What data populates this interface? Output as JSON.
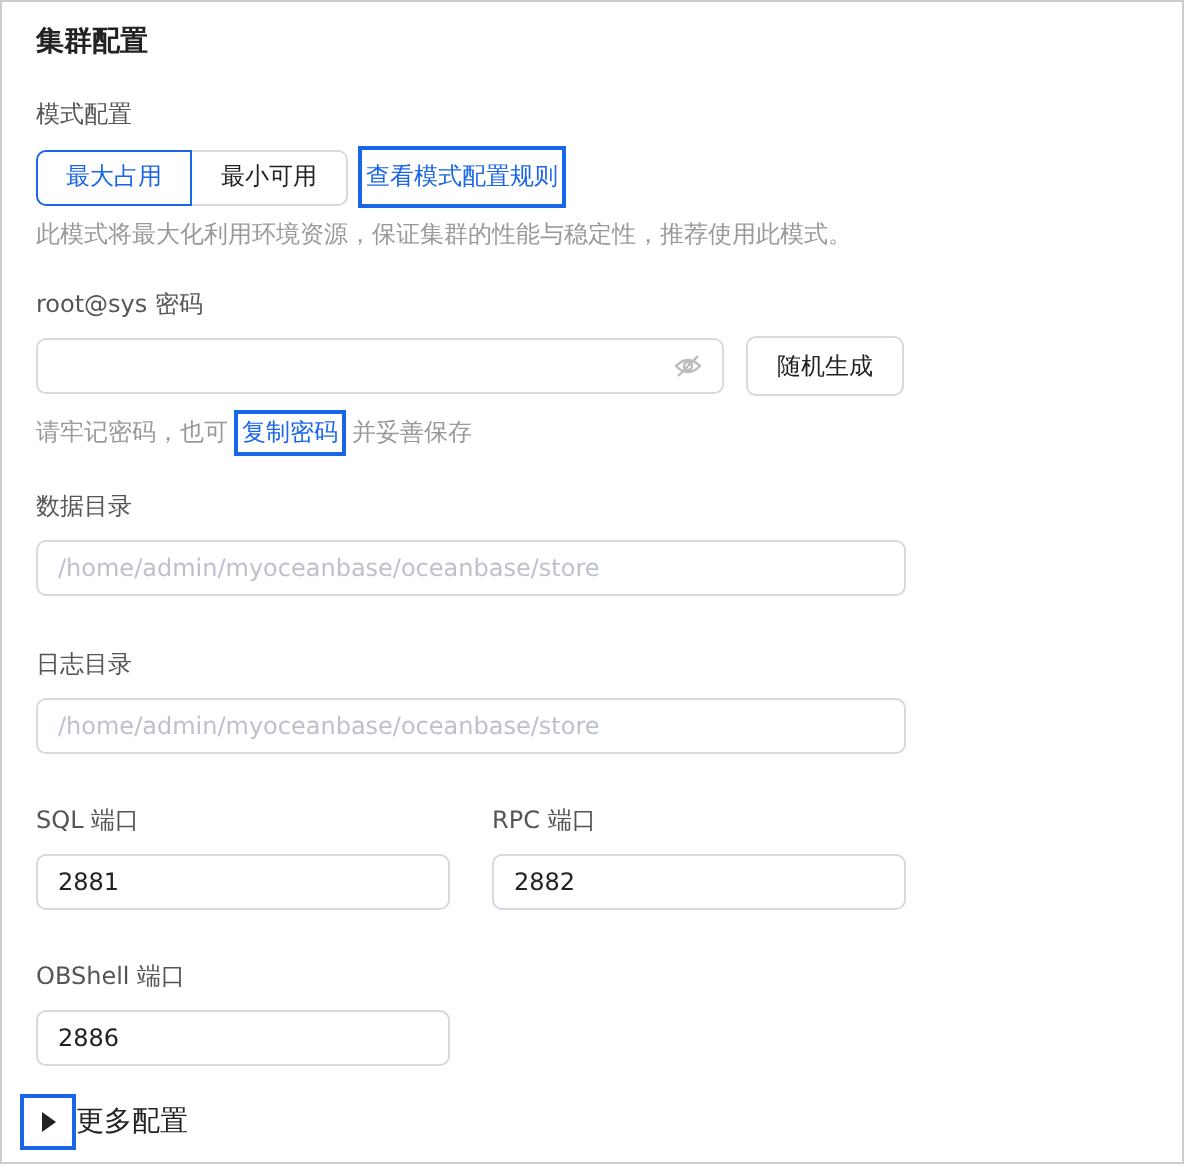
{
  "title": "集群配置",
  "mode": {
    "label": "模式配置",
    "options": [
      {
        "label": "最大占用",
        "selected": true
      },
      {
        "label": "最小可用",
        "selected": false
      }
    ],
    "rules_link": {
      "label": "查看模式配置规则",
      "highlighted": true
    },
    "description": "此模式将最大化利用环境资源，保证集群的性能与稳定性，推荐使用此模式。"
  },
  "password": {
    "label": "root@sys 密码",
    "generate_button": "随机生成",
    "hint_before": "请牢记密码，也可",
    "copy_link": {
      "label": "复制密码",
      "highlighted": true
    },
    "hint_after": "并妥善保存"
  },
  "data_dir": {
    "label": "数据目录",
    "placeholder": "/home/admin/myoceanbase/oceanbase/store"
  },
  "log_dir": {
    "label": "日志目录",
    "placeholder": "/home/admin/myoceanbase/oceanbase/store"
  },
  "ports": [
    {
      "label": "SQL 端口",
      "value": "2881"
    },
    {
      "label": "RPC 端口",
      "value": "2882"
    },
    {
      "label": "OBShell 端口",
      "value": "2886"
    }
  ],
  "more": {
    "label": "更多配置",
    "expanded": false,
    "highlighted": true
  }
}
